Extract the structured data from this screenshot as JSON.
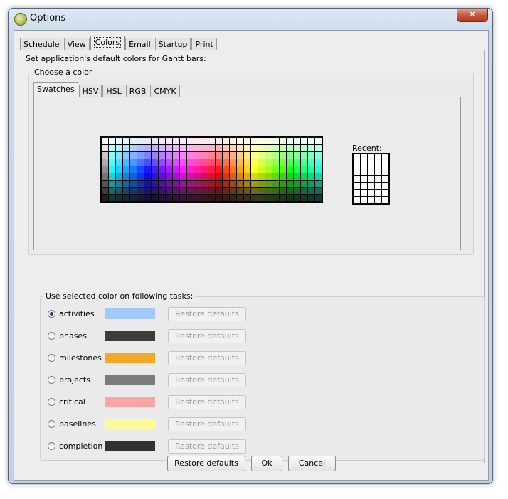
{
  "window": {
    "title": "Options",
    "close_glyph": "✕"
  },
  "tabs": [
    {
      "label": "Schedule"
    },
    {
      "label": "View"
    },
    {
      "label": "Colors",
      "active": true
    },
    {
      "label": "Email"
    },
    {
      "label": "Startup"
    },
    {
      "label": "Print"
    }
  ],
  "colors_tab": {
    "heading": "Set application's default colors for Gantt bars:",
    "choose_group": {
      "title": "Choose a color",
      "subtabs": [
        {
          "label": "Swatches",
          "active": true
        },
        {
          "label": "HSV"
        },
        {
          "label": "HSL"
        },
        {
          "label": "RGB"
        },
        {
          "label": "CMYK"
        }
      ],
      "recent_label": "Recent:"
    },
    "tasks_group": {
      "title": "Use selected color on following tasks:",
      "restore_label": "Restore defaults",
      "tasks": [
        {
          "label": "activities",
          "color": "#a3c8fa",
          "selected": true
        },
        {
          "label": "phases",
          "color": "#3c3c3c",
          "selected": false
        },
        {
          "label": "milestones",
          "color": "#f3a82a",
          "selected": false
        },
        {
          "label": "projects",
          "color": "#7c7c7c",
          "selected": false
        },
        {
          "label": "critical",
          "color": "#f9a5a5",
          "selected": false
        },
        {
          "label": "baselines",
          "color": "#fbfb9c",
          "selected": false
        },
        {
          "label": "completion",
          "color": "#313131",
          "selected": false
        }
      ]
    }
  },
  "footer": {
    "restore_defaults": "Restore defaults",
    "ok": "Ok",
    "cancel": "Cancel"
  }
}
